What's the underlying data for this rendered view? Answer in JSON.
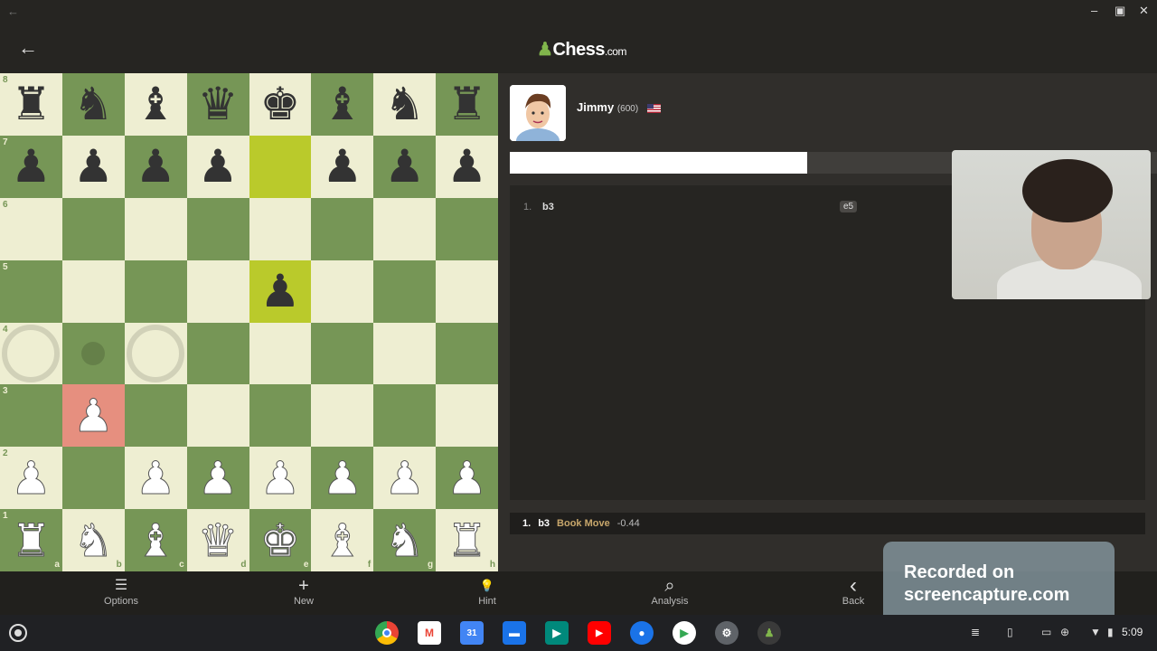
{
  "window": {
    "back_icon": "arrow-left-icon",
    "minimize": "–",
    "maximize": "▣",
    "close": "✕"
  },
  "header": {
    "back_icon": "arrow-left-icon",
    "logo_main": "Chess",
    "logo_suffix": ".com"
  },
  "board": {
    "ranks": [
      "8",
      "7",
      "6",
      "5",
      "4",
      "3",
      "2",
      "1"
    ],
    "files": [
      "a",
      "b",
      "c",
      "d",
      "e",
      "f",
      "g",
      "h"
    ],
    "highlight_squares": [
      "e7",
      "e5"
    ],
    "last_move_square": "b3",
    "hint_rings": [
      "a4",
      "c4"
    ],
    "hint_dots": [
      "b4"
    ],
    "position": {
      "a8": "bR",
      "b8": "bN",
      "c8": "bB",
      "d8": "bQ",
      "e8": "bK",
      "f8": "bB",
      "g8": "bN",
      "h8": "bR",
      "a7": "bP",
      "b7": "bP",
      "c7": "bP",
      "d7": "bP",
      "f7": "bP",
      "g7": "bP",
      "h7": "bP",
      "e5": "bP",
      "b3": "wP",
      "a2": "wP",
      "c2": "wP",
      "d2": "wP",
      "e2": "wP",
      "f2": "wP",
      "g2": "wP",
      "h2": "wP",
      "a1": "wR",
      "b1": "wN",
      "c1": "wB",
      "d1": "wQ",
      "e1": "wK",
      "f1": "wB",
      "g1": "wN",
      "h1": "wR"
    }
  },
  "opponent": {
    "name": "Jimmy",
    "rating": "(600)",
    "flag": "us-flag-icon"
  },
  "eval_bar": {
    "white_fraction": 0.46
  },
  "moves": [
    {
      "number": "1.",
      "white": "b3",
      "black": "e5"
    }
  ],
  "review": {
    "number": "1.",
    "move": "b3",
    "label": "Book Move",
    "eval": "-0.44"
  },
  "toolbar": [
    {
      "icon": "options-icon",
      "glyph": "☰",
      "label": "Options"
    },
    {
      "icon": "plus-icon",
      "glyph": "+",
      "label": "New"
    },
    {
      "icon": "lightbulb-icon",
      "glyph": "💡",
      "label": "Hint"
    },
    {
      "icon": "analysis-icon",
      "glyph": "⌕",
      "label": "Analysis"
    },
    {
      "icon": "chevron-left-icon",
      "glyph": "‹",
      "label": "Back"
    }
  ],
  "watermark": {
    "line1": "Recorded on",
    "line2": "screencapture.com"
  },
  "shelf": {
    "apps": [
      "chrome-icon",
      "gmail-icon",
      "calendar-icon",
      "files-icon",
      "meet-icon",
      "youtube-icon",
      "messages-icon",
      "play-store-icon",
      "settings-icon",
      "chess-app-icon"
    ],
    "calendar_day": "31",
    "time": "5:09"
  }
}
